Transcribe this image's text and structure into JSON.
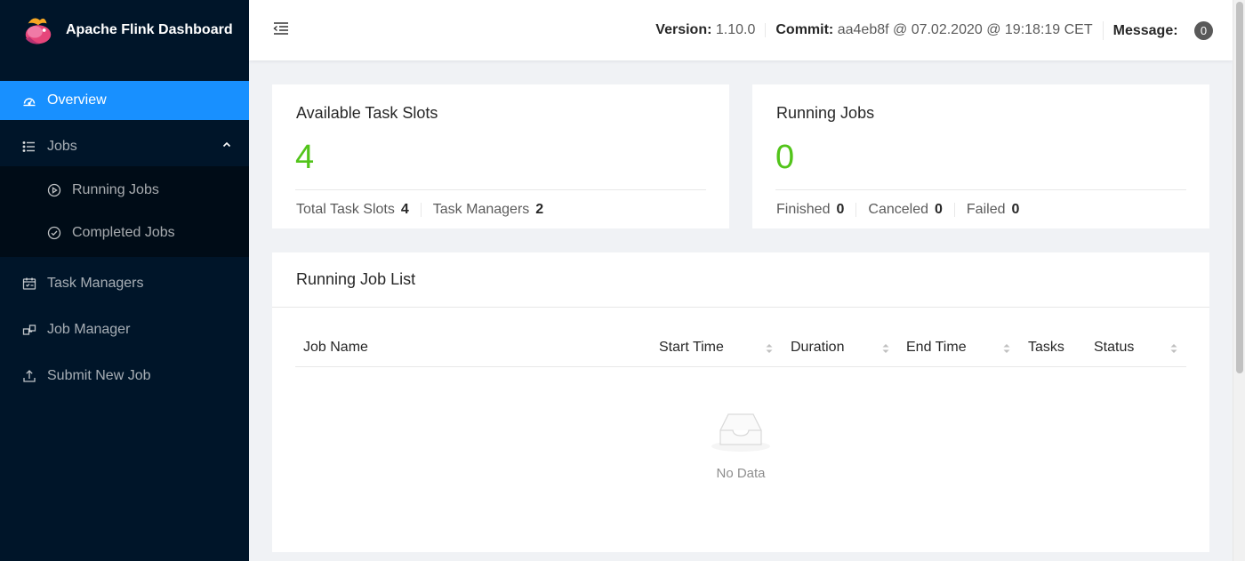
{
  "app": {
    "title": "Apache Flink Dashboard"
  },
  "sidebar": {
    "items": [
      {
        "label": "Overview",
        "icon": "dashboard-icon"
      },
      {
        "label": "Jobs",
        "icon": "list-icon"
      },
      {
        "label": "Running Jobs",
        "icon": "play-circle-icon"
      },
      {
        "label": "Completed Jobs",
        "icon": "check-circle-icon"
      },
      {
        "label": "Task Managers",
        "icon": "schedule-icon"
      },
      {
        "label": "Job Manager",
        "icon": "cluster-icon"
      },
      {
        "label": "Submit New Job",
        "icon": "upload-icon"
      }
    ]
  },
  "header": {
    "version_label": "Version:",
    "version_value": "1.10.0",
    "commit_label": "Commit:",
    "commit_value": "aa4eb8f @ 07.02.2020 @ 19:18:19 CET",
    "message_label": "Message:",
    "message_count": "0"
  },
  "slots_card": {
    "title": "Available Task Slots",
    "value": "4",
    "total_label": "Total Task Slots",
    "total_value": "4",
    "tm_label": "Task Managers",
    "tm_value": "2"
  },
  "jobs_card": {
    "title": "Running Jobs",
    "value": "0",
    "finished_label": "Finished",
    "finished_value": "0",
    "canceled_label": "Canceled",
    "canceled_value": "0",
    "failed_label": "Failed",
    "failed_value": "0"
  },
  "job_list": {
    "title": "Running Job List",
    "columns": [
      "Job Name",
      "Start Time",
      "Duration",
      "End Time",
      "Tasks",
      "Status"
    ],
    "empty_text": "No Data"
  },
  "colors": {
    "accent": "#1890ff",
    "success": "#52c41a",
    "sidebar": "#001529"
  }
}
